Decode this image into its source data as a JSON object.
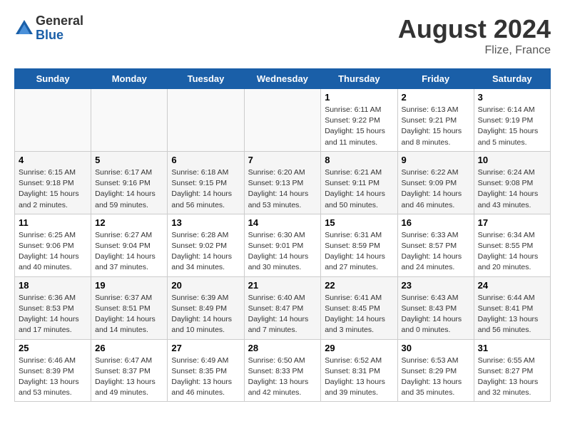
{
  "header": {
    "logo_general": "General",
    "logo_blue": "Blue",
    "month_year": "August 2024",
    "location": "Flize, France"
  },
  "days_of_week": [
    "Sunday",
    "Monday",
    "Tuesday",
    "Wednesday",
    "Thursday",
    "Friday",
    "Saturday"
  ],
  "weeks": [
    [
      {
        "day": "",
        "sunrise": "",
        "sunset": "",
        "daylight": ""
      },
      {
        "day": "",
        "sunrise": "",
        "sunset": "",
        "daylight": ""
      },
      {
        "day": "",
        "sunrise": "",
        "sunset": "",
        "daylight": ""
      },
      {
        "day": "",
        "sunrise": "",
        "sunset": "",
        "daylight": ""
      },
      {
        "day": "1",
        "sunrise": "Sunrise: 6:11 AM",
        "sunset": "Sunset: 9:22 PM",
        "daylight": "Daylight: 15 hours and 11 minutes."
      },
      {
        "day": "2",
        "sunrise": "Sunrise: 6:13 AM",
        "sunset": "Sunset: 9:21 PM",
        "daylight": "Daylight: 15 hours and 8 minutes."
      },
      {
        "day": "3",
        "sunrise": "Sunrise: 6:14 AM",
        "sunset": "Sunset: 9:19 PM",
        "daylight": "Daylight: 15 hours and 5 minutes."
      }
    ],
    [
      {
        "day": "4",
        "sunrise": "Sunrise: 6:15 AM",
        "sunset": "Sunset: 9:18 PM",
        "daylight": "Daylight: 15 hours and 2 minutes."
      },
      {
        "day": "5",
        "sunrise": "Sunrise: 6:17 AM",
        "sunset": "Sunset: 9:16 PM",
        "daylight": "Daylight: 14 hours and 59 minutes."
      },
      {
        "day": "6",
        "sunrise": "Sunrise: 6:18 AM",
        "sunset": "Sunset: 9:15 PM",
        "daylight": "Daylight: 14 hours and 56 minutes."
      },
      {
        "day": "7",
        "sunrise": "Sunrise: 6:20 AM",
        "sunset": "Sunset: 9:13 PM",
        "daylight": "Daylight: 14 hours and 53 minutes."
      },
      {
        "day": "8",
        "sunrise": "Sunrise: 6:21 AM",
        "sunset": "Sunset: 9:11 PM",
        "daylight": "Daylight: 14 hours and 50 minutes."
      },
      {
        "day": "9",
        "sunrise": "Sunrise: 6:22 AM",
        "sunset": "Sunset: 9:09 PM",
        "daylight": "Daylight: 14 hours and 46 minutes."
      },
      {
        "day": "10",
        "sunrise": "Sunrise: 6:24 AM",
        "sunset": "Sunset: 9:08 PM",
        "daylight": "Daylight: 14 hours and 43 minutes."
      }
    ],
    [
      {
        "day": "11",
        "sunrise": "Sunrise: 6:25 AM",
        "sunset": "Sunset: 9:06 PM",
        "daylight": "Daylight: 14 hours and 40 minutes."
      },
      {
        "day": "12",
        "sunrise": "Sunrise: 6:27 AM",
        "sunset": "Sunset: 9:04 PM",
        "daylight": "Daylight: 14 hours and 37 minutes."
      },
      {
        "day": "13",
        "sunrise": "Sunrise: 6:28 AM",
        "sunset": "Sunset: 9:02 PM",
        "daylight": "Daylight: 14 hours and 34 minutes."
      },
      {
        "day": "14",
        "sunrise": "Sunrise: 6:30 AM",
        "sunset": "Sunset: 9:01 PM",
        "daylight": "Daylight: 14 hours and 30 minutes."
      },
      {
        "day": "15",
        "sunrise": "Sunrise: 6:31 AM",
        "sunset": "Sunset: 8:59 PM",
        "daylight": "Daylight: 14 hours and 27 minutes."
      },
      {
        "day": "16",
        "sunrise": "Sunrise: 6:33 AM",
        "sunset": "Sunset: 8:57 PM",
        "daylight": "Daylight: 14 hours and 24 minutes."
      },
      {
        "day": "17",
        "sunrise": "Sunrise: 6:34 AM",
        "sunset": "Sunset: 8:55 PM",
        "daylight": "Daylight: 14 hours and 20 minutes."
      }
    ],
    [
      {
        "day": "18",
        "sunrise": "Sunrise: 6:36 AM",
        "sunset": "Sunset: 8:53 PM",
        "daylight": "Daylight: 14 hours and 17 minutes."
      },
      {
        "day": "19",
        "sunrise": "Sunrise: 6:37 AM",
        "sunset": "Sunset: 8:51 PM",
        "daylight": "Daylight: 14 hours and 14 minutes."
      },
      {
        "day": "20",
        "sunrise": "Sunrise: 6:39 AM",
        "sunset": "Sunset: 8:49 PM",
        "daylight": "Daylight: 14 hours and 10 minutes."
      },
      {
        "day": "21",
        "sunrise": "Sunrise: 6:40 AM",
        "sunset": "Sunset: 8:47 PM",
        "daylight": "Daylight: 14 hours and 7 minutes."
      },
      {
        "day": "22",
        "sunrise": "Sunrise: 6:41 AM",
        "sunset": "Sunset: 8:45 PM",
        "daylight": "Daylight: 14 hours and 3 minutes."
      },
      {
        "day": "23",
        "sunrise": "Sunrise: 6:43 AM",
        "sunset": "Sunset: 8:43 PM",
        "daylight": "Daylight: 14 hours and 0 minutes."
      },
      {
        "day": "24",
        "sunrise": "Sunrise: 6:44 AM",
        "sunset": "Sunset: 8:41 PM",
        "daylight": "Daylight: 13 hours and 56 minutes."
      }
    ],
    [
      {
        "day": "25",
        "sunrise": "Sunrise: 6:46 AM",
        "sunset": "Sunset: 8:39 PM",
        "daylight": "Daylight: 13 hours and 53 minutes."
      },
      {
        "day": "26",
        "sunrise": "Sunrise: 6:47 AM",
        "sunset": "Sunset: 8:37 PM",
        "daylight": "Daylight: 13 hours and 49 minutes."
      },
      {
        "day": "27",
        "sunrise": "Sunrise: 6:49 AM",
        "sunset": "Sunset: 8:35 PM",
        "daylight": "Daylight: 13 hours and 46 minutes."
      },
      {
        "day": "28",
        "sunrise": "Sunrise: 6:50 AM",
        "sunset": "Sunset: 8:33 PM",
        "daylight": "Daylight: 13 hours and 42 minutes."
      },
      {
        "day": "29",
        "sunrise": "Sunrise: 6:52 AM",
        "sunset": "Sunset: 8:31 PM",
        "daylight": "Daylight: 13 hours and 39 minutes."
      },
      {
        "day": "30",
        "sunrise": "Sunrise: 6:53 AM",
        "sunset": "Sunset: 8:29 PM",
        "daylight": "Daylight: 13 hours and 35 minutes."
      },
      {
        "day": "31",
        "sunrise": "Sunrise: 6:55 AM",
        "sunset": "Sunset: 8:27 PM",
        "daylight": "Daylight: 13 hours and 32 minutes."
      }
    ]
  ]
}
